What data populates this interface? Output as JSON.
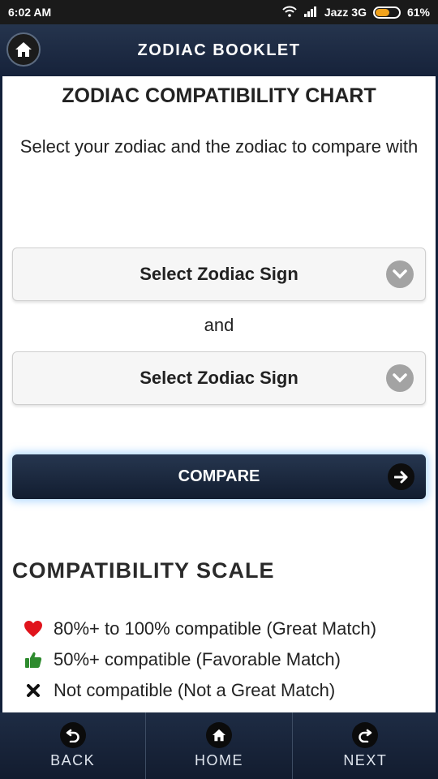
{
  "status_bar": {
    "time": "6:02 AM",
    "carrier": "Jazz 3G",
    "battery_percent": "61%",
    "battery_level": 0.61
  },
  "header": {
    "title": "ZODIAC BOOKLET"
  },
  "main": {
    "chart_title": "ZODIAC COMPATIBILITY CHART",
    "instructions": "Select your zodiac and the zodiac to compare with",
    "select_1": {
      "label": "Select Zodiac Sign"
    },
    "connector": "and",
    "select_2": {
      "label": "Select Zodiac Sign"
    },
    "compare_button": "COMPARE"
  },
  "scale": {
    "title": "COMPATIBILITY SCALE",
    "items": [
      {
        "icon": "heart-icon",
        "color": "#e0141c",
        "text": "80%+ to 100% compatible (Great Match)"
      },
      {
        "icon": "thumbs-up-icon",
        "color": "#2e8b2e",
        "text": "50%+ compatible (Favorable Match)"
      },
      {
        "icon": "cross-icon",
        "color": "#111111",
        "text": "Not compatible (Not a Great Match)"
      }
    ]
  },
  "bottom_nav": {
    "back": "BACK",
    "home": "HOME",
    "next": "NEXT"
  }
}
